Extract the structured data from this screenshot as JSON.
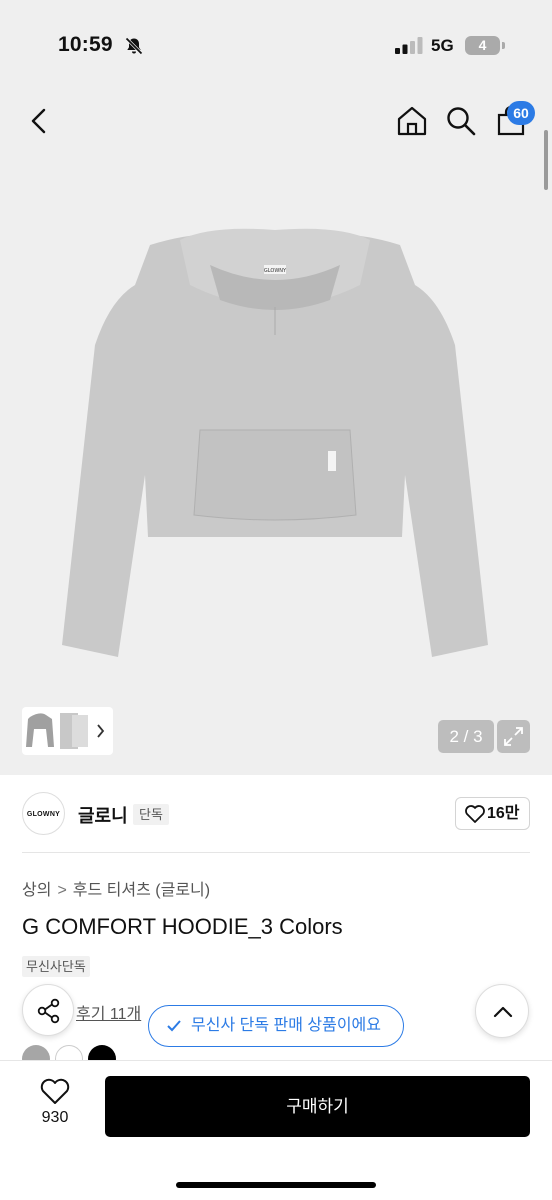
{
  "status_bar": {
    "time": "10:59",
    "network": "5G",
    "battery": "4"
  },
  "nav": {
    "cart_count": "60"
  },
  "product_label_text": "GLOWNY",
  "gallery": {
    "pager": "2 / 3"
  },
  "brand": {
    "logo_text": "GLOWNY",
    "name": "글로니",
    "tag": "단독",
    "likes": "16만"
  },
  "breadcrumb": {
    "items": [
      "상의",
      "후드 티셔츠 (글로니)"
    ],
    "separator": ">"
  },
  "product": {
    "title": "G COMFORT HOODIE_3 Colors",
    "exclusive_tag": "무신사단독",
    "review_text": "후기 11개"
  },
  "toast": {
    "text": "무신사 단독 판매 상품이에요"
  },
  "color_swatches": [
    "#a6a6a6",
    "#ffffff",
    "#000000"
  ],
  "bottom_bar": {
    "like_count": "930",
    "buy_label": "구매하기"
  },
  "colors": {
    "accent_blue": "#2c7be5",
    "hero_bg": "#efefef"
  }
}
